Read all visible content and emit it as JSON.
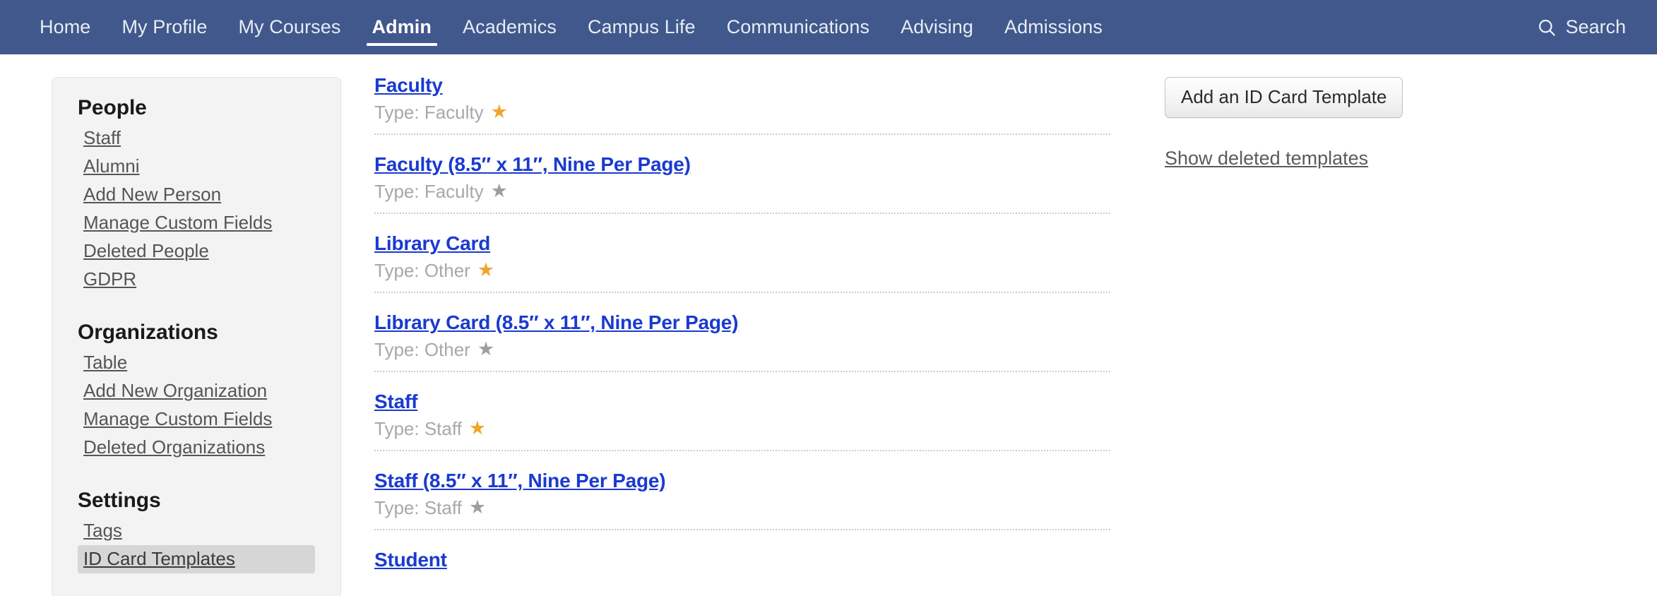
{
  "navbar": {
    "items": [
      {
        "label": "Home",
        "active": false
      },
      {
        "label": "My Profile",
        "active": false
      },
      {
        "label": "My Courses",
        "active": false
      },
      {
        "label": "Admin",
        "active": true
      },
      {
        "label": "Academics",
        "active": false
      },
      {
        "label": "Campus Life",
        "active": false
      },
      {
        "label": "Communications",
        "active": false
      },
      {
        "label": "Advising",
        "active": false
      },
      {
        "label": "Admissions",
        "active": false
      }
    ],
    "search_label": "Search",
    "search_icon": "search-icon",
    "background_color": "#41588c",
    "text_color": "#e8ecf4"
  },
  "sidebar": {
    "groups": [
      {
        "heading": "People",
        "links": [
          {
            "label": "Staff",
            "selected": false
          },
          {
            "label": "Alumni",
            "selected": false
          },
          {
            "label": "Add New Person",
            "selected": false
          },
          {
            "label": "Manage Custom Fields",
            "selected": false
          },
          {
            "label": "Deleted People",
            "selected": false
          },
          {
            "label": "GDPR",
            "selected": false
          }
        ]
      },
      {
        "heading": "Organizations",
        "links": [
          {
            "label": "Table",
            "selected": false
          },
          {
            "label": "Add New Organization",
            "selected": false
          },
          {
            "label": "Manage Custom Fields",
            "selected": false
          },
          {
            "label": "Deleted Organizations",
            "selected": false
          }
        ]
      },
      {
        "heading": "Settings",
        "links": [
          {
            "label": "Tags",
            "selected": false
          },
          {
            "label": "ID Card Templates",
            "selected": true
          }
        ]
      }
    ]
  },
  "main": {
    "templates": [
      {
        "title": "Faculty",
        "meta": "Type: Faculty",
        "starred": true
      },
      {
        "title": "Faculty (8.5″ x 11″, Nine Per Page)",
        "meta": "Type: Faculty",
        "starred": false
      },
      {
        "title": "Library Card",
        "meta": "Type: Other",
        "starred": true
      },
      {
        "title": "Library Card (8.5″ x 11″, Nine Per Page)",
        "meta": "Type: Other",
        "starred": false
      },
      {
        "title": "Staff",
        "meta": "Type: Staff",
        "starred": true
      },
      {
        "title": "Staff (8.5″ x 11″, Nine Per Page)",
        "meta": "Type: Staff",
        "starred": false
      },
      {
        "title": "Student",
        "meta": "",
        "starred": null
      }
    ]
  },
  "right_panel": {
    "add_button_label": "Add an ID Card Template",
    "show_deleted_label": "Show deleted templates"
  },
  "colors": {
    "nav_blue": "#41588c",
    "link_blue": "#1a3ad0",
    "star_on": "#f2a52b",
    "star_off": "#9e9e9e",
    "meta_gray": "#a8a8a8",
    "sidebar_bg": "#f3f3f3",
    "sidebar_selected": "#d6d6d6"
  }
}
